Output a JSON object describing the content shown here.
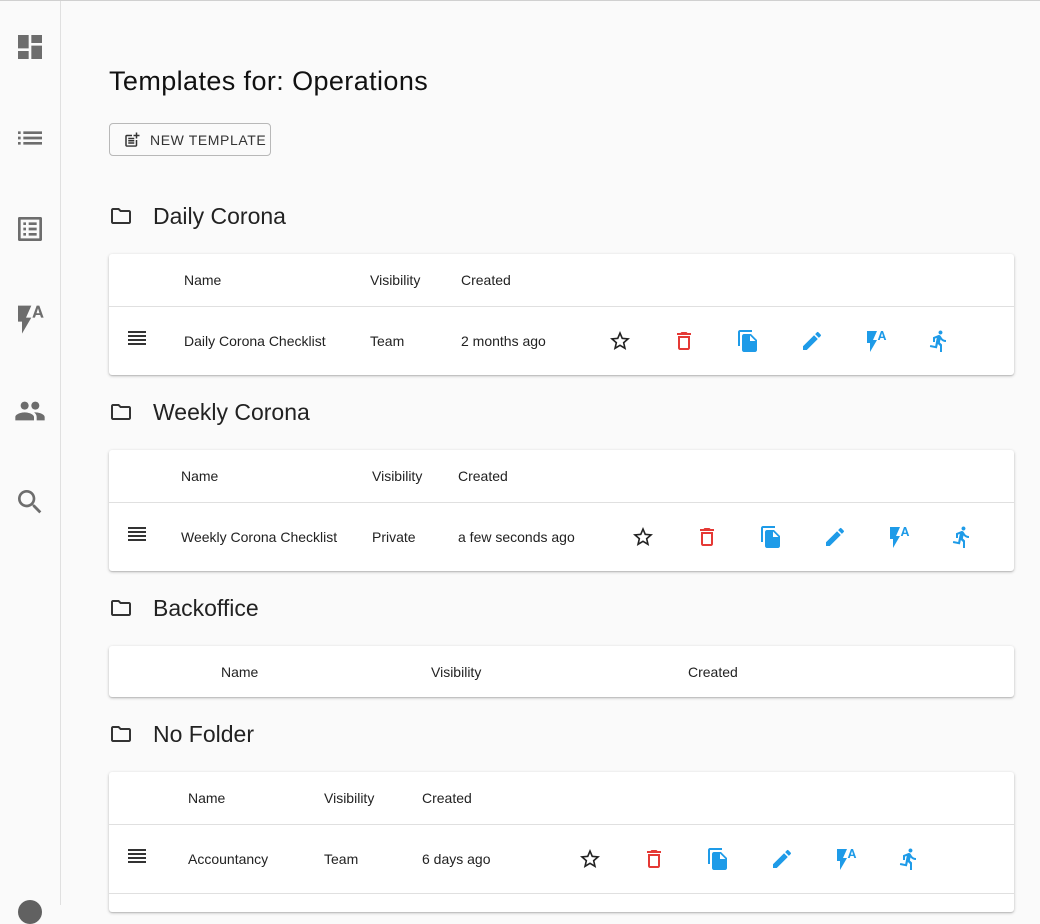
{
  "page": {
    "title": "Templates for: Operations",
    "new_template_label": "NEW TEMPLATE"
  },
  "sidebar": {
    "items": [
      {
        "icon": "dashboard-icon"
      },
      {
        "icon": "list-icon"
      },
      {
        "icon": "list-alt-icon"
      },
      {
        "icon": "flash-auto-icon"
      },
      {
        "icon": "people-icon"
      },
      {
        "icon": "search-icon"
      }
    ]
  },
  "folders": [
    {
      "name": "Daily Corona",
      "headers": {
        "name": "Name",
        "visibility": "Visibility",
        "created": "Created"
      },
      "rows": [
        {
          "name": "Daily Corona Checklist",
          "visibility": "Team",
          "created": "2 months ago"
        }
      ]
    },
    {
      "name": "Weekly Corona",
      "headers": {
        "name": "Name",
        "visibility": "Visibility",
        "created": "Created"
      },
      "rows": [
        {
          "name": "Weekly Corona Checklist",
          "visibility": "Private",
          "created": "a few seconds ago"
        }
      ]
    },
    {
      "name": "Backoffice",
      "headers": {
        "name": "Name",
        "visibility": "Visibility",
        "created": "Created"
      },
      "rows": []
    },
    {
      "name": "No Folder",
      "headers": {
        "name": "Name",
        "visibility": "Visibility",
        "created": "Created"
      },
      "rows": [
        {
          "name": "Accountancy",
          "visibility": "Team",
          "created": "6 days ago"
        }
      ]
    }
  ],
  "colors": {
    "accent_blue": "#1e9be8",
    "delete_red": "#e53935",
    "sidebar_icon": "#6d6d6d"
  }
}
